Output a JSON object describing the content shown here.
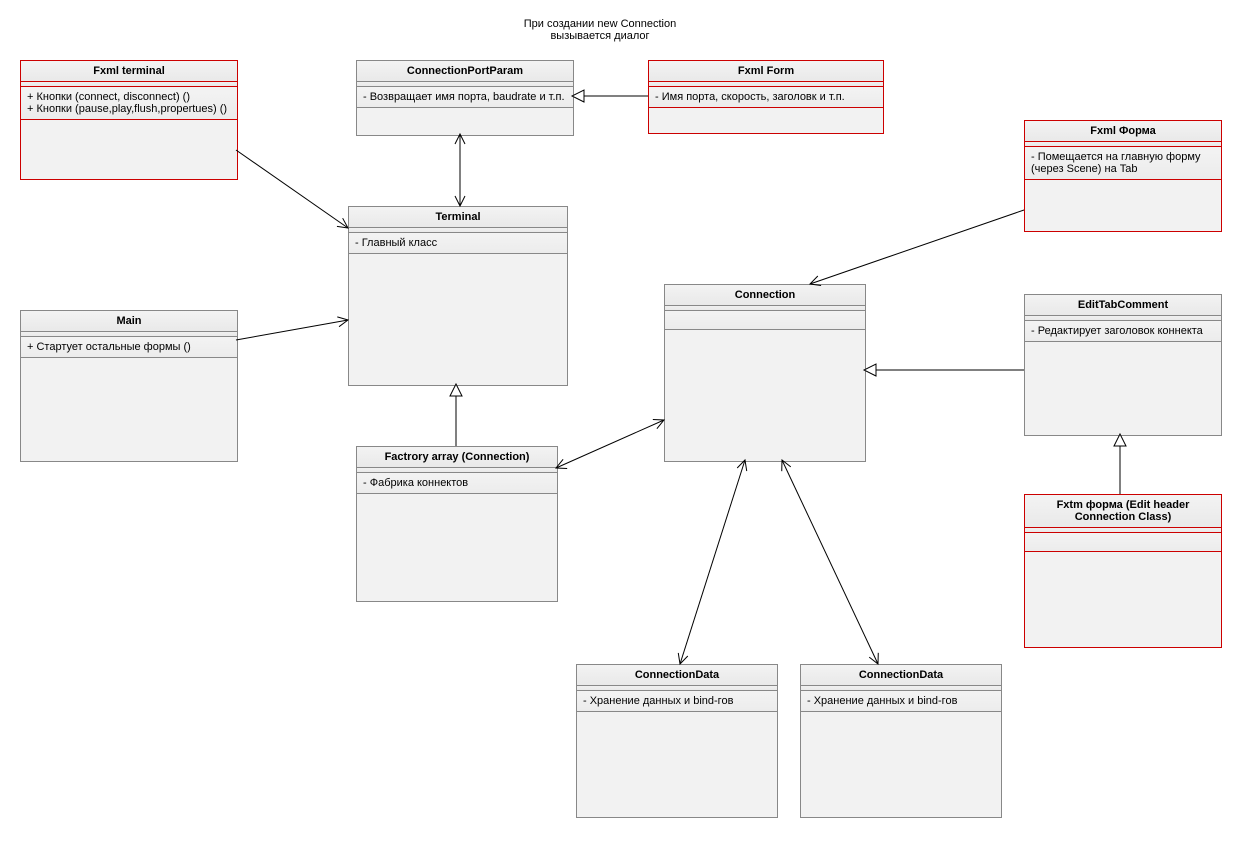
{
  "noteTop": "При создании new Connection\nвызывается диалог",
  "classes": {
    "fxmlTerminal": {
      "title": "Fxml terminal",
      "attrs": "+ Кнопки (connect, disconnect) ()\n+ Кнопки (pause,play,flush,propertues) ()"
    },
    "connectionPortParam": {
      "title": "ConnectionPortParam",
      "attrs": "- Возвращает имя порта, baudrate и т.п."
    },
    "fxmlForm": {
      "title": "Fxml Form",
      "attrs": "- Имя порта, скорость, заголовк и т.п."
    },
    "terminal": {
      "title": "Terminal",
      "attrs": "- Главный класс"
    },
    "main": {
      "title": "Main",
      "attrs": "+ Стартует остальные формы ()"
    },
    "fxmlForma": {
      "title": "Fxml Форма",
      "attrs": "- Помещается на главную форму (через Scene) на Tab"
    },
    "connection": {
      "title": "Connection",
      "attrs": ""
    },
    "editTabComment": {
      "title": "EditTabComment",
      "attrs": "- Редактирует заголовок коннекта"
    },
    "factoryArray": {
      "title": "Factrory array (Connection)",
      "attrs": "- Фабрика коннектов"
    },
    "fxtmForma": {
      "title": "Fxtm форма (Edit header Connection Class)"
    },
    "connectionData1": {
      "title": "ConnectionData",
      "attrs": "- Хранение данных и bind-гов"
    },
    "connectionData2": {
      "title": "ConnectionData",
      "attrs": "- Хранение данных и bind-гов"
    }
  }
}
